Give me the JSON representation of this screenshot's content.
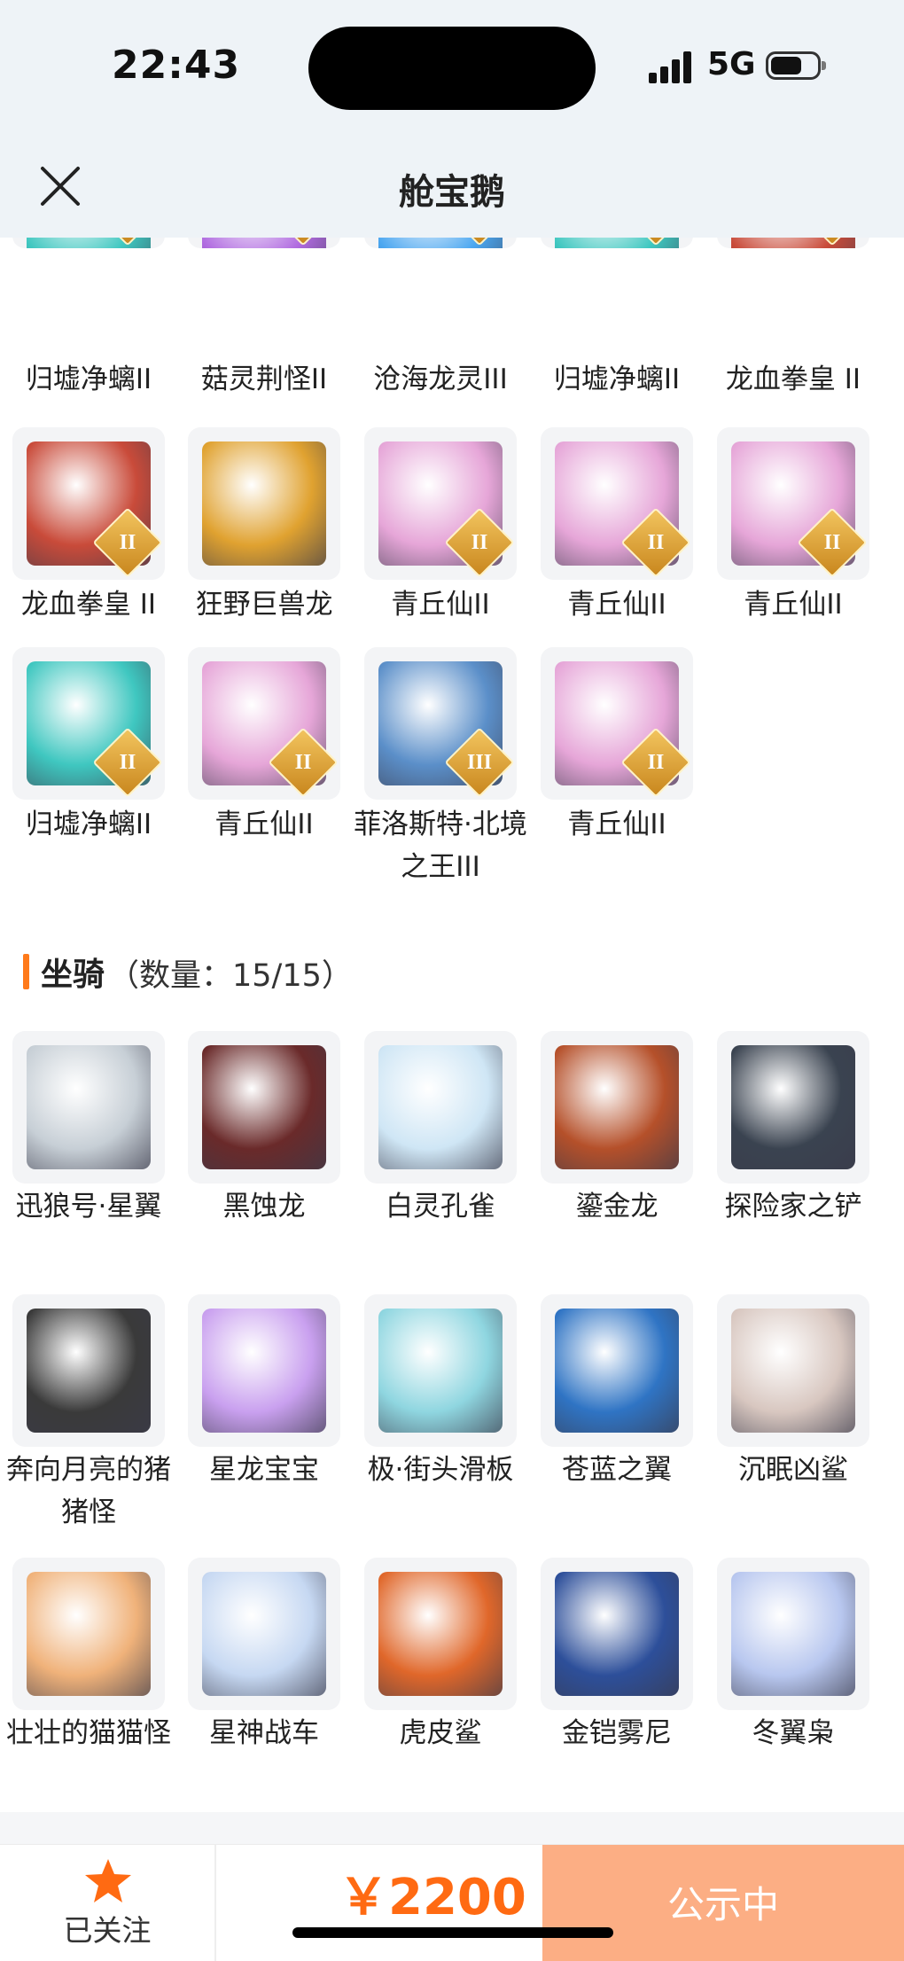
{
  "status_bar": {
    "time": "22:43",
    "network": "5G"
  },
  "header": {
    "title": "舱宝鹅",
    "close_icon": "close-icon"
  },
  "pets_partial": [
    {
      "name": "归墟净螭II",
      "rank": "II",
      "color": "#3fc7c0"
    },
    {
      "name": "菇灵荆怪II",
      "rank": "II",
      "color": "#b06ae0"
    },
    {
      "name": "沧海龙灵III",
      "rank": "III",
      "color": "#4aa6f0"
    },
    {
      "name": "归墟净螭II",
      "rank": "II",
      "color": "#3fc7c0"
    },
    {
      "name": "龙血拳皇 II",
      "rank": "II",
      "color": "#c94b3a"
    },
    {
      "name": "龙血拳皇 II",
      "rank": "II",
      "color": "#c94b3a"
    },
    {
      "name": "狂野巨兽龙",
      "rank": "",
      "color": "#e0a230"
    },
    {
      "name": "青丘仙II",
      "rank": "II",
      "color": "#e6a6d8"
    },
    {
      "name": "青丘仙II",
      "rank": "II",
      "color": "#e6a6d8"
    },
    {
      "name": "青丘仙II",
      "rank": "II",
      "color": "#e6a6d8"
    },
    {
      "name": "归墟净螭II",
      "rank": "II",
      "color": "#3fc7c0"
    },
    {
      "name": "青丘仙II",
      "rank": "II",
      "color": "#e6a6d8"
    },
    {
      "name": "菲洛斯特·北境之王III",
      "rank": "III",
      "color": "#5b8fc9"
    },
    {
      "name": "青丘仙II",
      "rank": "II",
      "color": "#e6a6d8"
    }
  ],
  "mounts_section": {
    "title": "坐骑",
    "count": "（数量：15/15）"
  },
  "mounts": [
    {
      "name": "迅狼号·星翼",
      "color": "#c7cfd6"
    },
    {
      "name": "黑蚀龙",
      "color": "#6a2a2a"
    },
    {
      "name": "白灵孔雀",
      "color": "#cfe6f5"
    },
    {
      "name": "鎏金龙",
      "color": "#b5502a"
    },
    {
      "name": "探险家之铲",
      "color": "#3a4350"
    },
    {
      "name": "奔向月亮的猪猪怪",
      "color": "#3a3a3a"
    },
    {
      "name": "星龙宝宝",
      "color": "#c9a0ef"
    },
    {
      "name": "极·街头滑板",
      "color": "#8fd6e0"
    },
    {
      "name": "苍蓝之翼",
      "color": "#2f74c4"
    },
    {
      "name": "沉眠凶鲨",
      "color": "#d8c7c0"
    },
    {
      "name": "壮壮的猫猫怪",
      "color": "#f0b27a"
    },
    {
      "name": "星神战车",
      "color": "#c6d8f2"
    },
    {
      "name": "虎皮鲨",
      "color": "#e0672a"
    },
    {
      "name": "金铠雾尼",
      "color": "#2d4f9a"
    },
    {
      "name": "冬翼枭",
      "color": "#b8c7ef"
    }
  ],
  "bottom_bar": {
    "follow_label": "已关注",
    "price": "￥2200",
    "cta_label": "公示中",
    "accent": "#ff6a12"
  }
}
